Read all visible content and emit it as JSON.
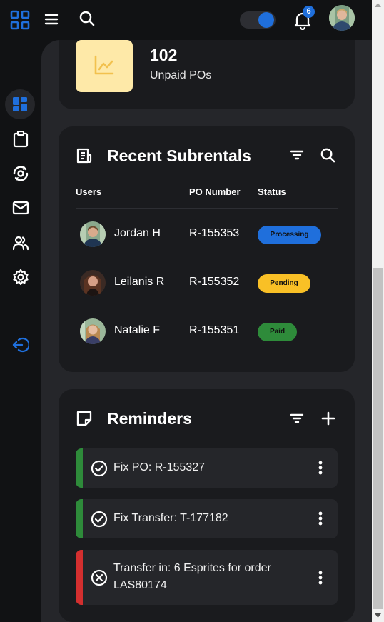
{
  "header": {
    "notification_count": "6"
  },
  "summary": {
    "value": "102",
    "label": "Unpaid POs"
  },
  "subrentals": {
    "title": "Recent Subrentals",
    "columns": [
      "Users",
      "PO Number",
      "Status"
    ],
    "rows": [
      {
        "user": "Jordan H",
        "po": "R-155353",
        "status": "Processing"
      },
      {
        "user": "Leilanis R",
        "po": "R-155352",
        "status": "Pending"
      },
      {
        "user": "Natalie F",
        "po": "R-155351",
        "status": "Paid"
      }
    ]
  },
  "reminders": {
    "title": "Reminders",
    "items": [
      {
        "text": "Fix PO: R-155327",
        "state": "done"
      },
      {
        "text": "Fix Transfer: T-177182",
        "state": "done"
      },
      {
        "text_line1": "Transfer in: 6 Esprites for order",
        "text_line2": "LAS80174",
        "state": "cancelled"
      }
    ]
  },
  "colors": {
    "accent": "#1f6fdc",
    "processing": "#1f6fdc",
    "pending": "#f9c026",
    "paid": "#2e8b3a",
    "reminder_ok": "#2e8b3a",
    "reminder_error": "#d32f2f",
    "tile": "#fee9a8"
  },
  "icons": [
    "apps-grid-icon",
    "hamburger-menu-icon",
    "search-icon",
    "theme-toggle",
    "bell-icon",
    "user-avatar",
    "dashboard-icon",
    "clipboard-icon",
    "rental-sync-icon",
    "mail-icon",
    "users-icon",
    "gear-icon",
    "logout-icon",
    "chart-icon",
    "receipt-icon",
    "filter-icon",
    "add-icon",
    "check-circle-icon",
    "cancel-circle-icon",
    "more-vert-icon"
  ]
}
